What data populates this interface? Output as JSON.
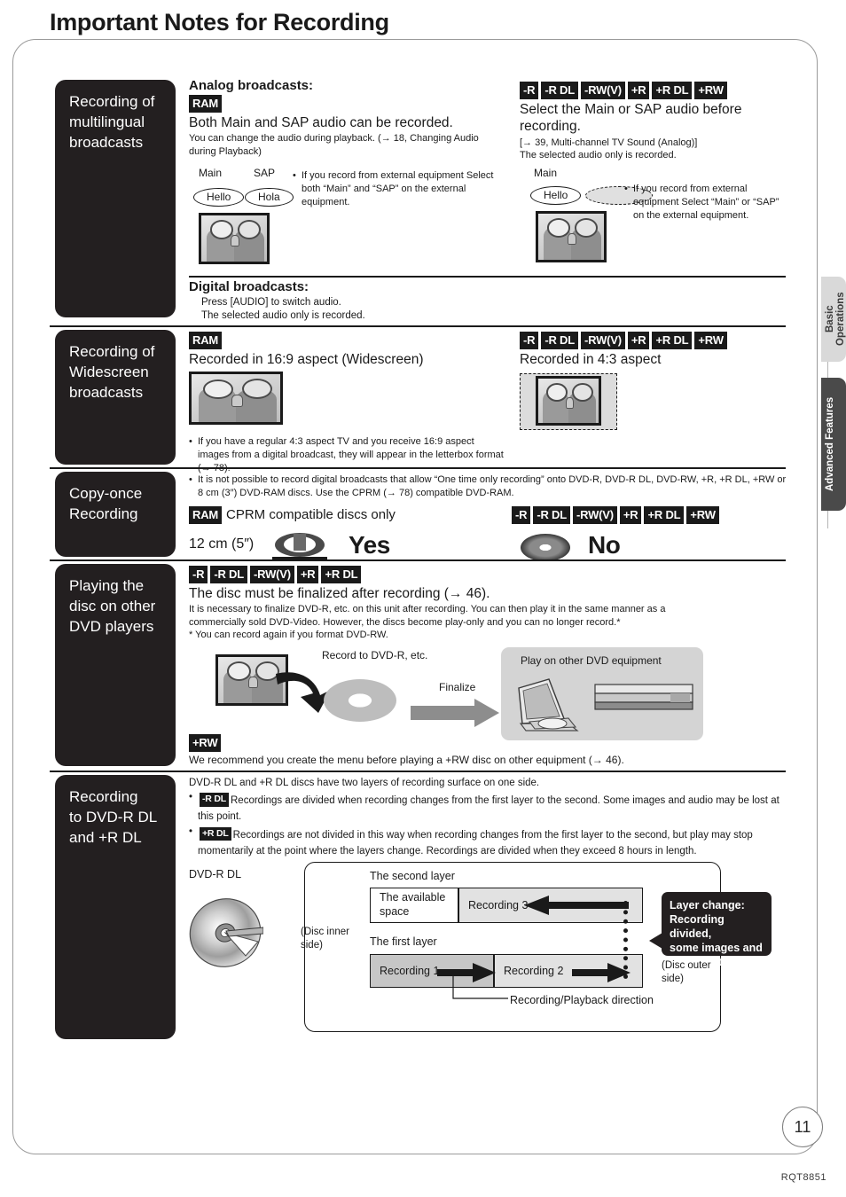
{
  "page": {
    "title": "Important Notes for Recording",
    "number": "11",
    "doc_code": "RQT8851"
  },
  "side_tabs": [
    {
      "label": "Basic Operations",
      "style": "light"
    },
    {
      "label": "Advanced Features",
      "style": "dark"
    }
  ],
  "sections": [
    {
      "id": "multilingual",
      "heading": "Recording of\nmultilingual\nbroadcasts",
      "analog_heading": "Analog broadcasts:",
      "left": {
        "tags": [
          "RAM"
        ],
        "headline": "Both Main and SAP audio can be recorded.",
        "note": "You can change the audio during playback. (→ 18, Changing Audio during Playback)",
        "bubble_labels": [
          "Main",
          "SAP"
        ],
        "bubbles": [
          "Hello",
          "Hola"
        ],
        "bullet": "If you record from external equipment Select both “Main” and “SAP” on the external equipment."
      },
      "right": {
        "tags": [
          "-R",
          "-R DL",
          "-RW(V)",
          "+R",
          "+R DL",
          "+RW"
        ],
        "headline": "Select the Main or SAP audio before recording.",
        "note1": "[→ 39, Multi-channel TV Sound (Analog)]",
        "note2": "The selected audio only is recorded.",
        "bubble_labels": [
          "Main"
        ],
        "bubbles": [
          "Hello",
          ""
        ],
        "bullet": "If you record from external equipment Select “Main” or “SAP” on the external equipment."
      },
      "digital_heading": "Digital broadcasts:",
      "digital_lines": [
        "Press [AUDIO] to switch audio.",
        "The selected audio only is recorded."
      ]
    },
    {
      "id": "widescreen",
      "heading": "Recording of\nWidescreen\nbroadcasts",
      "left": {
        "tags": [
          "RAM"
        ],
        "headline": "Recorded in 16:9 aspect (Widescreen)",
        "bullet": "If you have a regular 4:3 aspect TV and you receive 16:9 aspect images from a digital broadcast, they will appear in the letterbox format (→ 78)."
      },
      "right": {
        "tags": [
          "-R",
          "-R DL",
          "-RW(V)",
          "+R",
          "+R DL",
          "+RW"
        ],
        "headline": "Recorded in 4:3 aspect"
      }
    },
    {
      "id": "copy-once",
      "heading": "Copy-once\nRecording",
      "bullet": "It is not possible to record digital broadcasts that allow “One time only recording” onto DVD-R, DVD-R DL, DVD-RW, +R, +R DL, +RW or 8 cm (3″) DVD-RAM discs. Use the CPRM (→ 78) compatible DVD-RAM.",
      "ram_tag": "RAM",
      "ram_text": "CPRM compatible discs only",
      "right_tags": [
        "-R",
        "-R DL",
        "-RW(V)",
        "+R",
        "+R DL",
        "+RW"
      ],
      "size_label": "12 cm (5″)",
      "yes_label": "Yes",
      "no_label": "No"
    },
    {
      "id": "other-players",
      "heading": "Playing the\ndisc on other\nDVD players",
      "tags": [
        "-R",
        "-R DL",
        "-RW(V)",
        "+R",
        "+R DL"
      ],
      "headline": "The disc must be finalized after recording (→ 46).",
      "body_lines": [
        "It is necessary to finalize DVD-R, etc. on this unit after recording. You can then play it in the same manner as a",
        "commercially sold DVD-Video. However, the discs become play-only and you can no longer record.*",
        "* You can record again if you format DVD-RW."
      ],
      "flow": {
        "record_label": "Record to DVD-R, etc.",
        "finalize_label": "Finalize",
        "play_label": "Play on other DVD equipment"
      },
      "rw_tag": "+RW",
      "rw_text": "We recommend you create the menu before playing a +RW disc on other equipment (→ 46)."
    },
    {
      "id": "dl-recording",
      "heading": "Recording\nto DVD-R DL\nand +R DL",
      "intro": "DVD-R DL and +R DL discs have two layers of recording surface on one side.",
      "bullets": [
        {
          "tag": "-R DL",
          "text": "Recordings are divided when recording changes from the first layer to the second. Some images and audio may be lost at this point."
        },
        {
          "tag": "+R DL",
          "text": "Recordings are not divided in this way when recording changes from the first layer to the second, but play may stop momentarily at the point where the layers change. Recordings are divided when they exceed 8 hours in length."
        }
      ],
      "diagram": {
        "disc_label": "DVD-R DL",
        "inner_label": "(Disc inner\nside)",
        "outer_label": "(Disc outer\nside)",
        "second_layer_label": "The second layer",
        "first_layer_label": "The first layer",
        "available_space": "The available\nspace",
        "recording3": "Recording 3",
        "recording1": "Recording 1",
        "recording2": "Recording 2",
        "direction_label": "Recording/Playback direction",
        "callout": "Layer change:\nRecording divided,\nsome images and\naudio lost."
      }
    }
  ],
  "colors": {
    "black_block": "#231f20",
    "frame": "#9a9a9a",
    "tab_light": "#d9d9d9",
    "tab_dark": "#4a4a4a",
    "bar_light": "#e2e2e2",
    "bar_dark": "#c6c6c6",
    "flow_bg": "#d4d4d4"
  }
}
